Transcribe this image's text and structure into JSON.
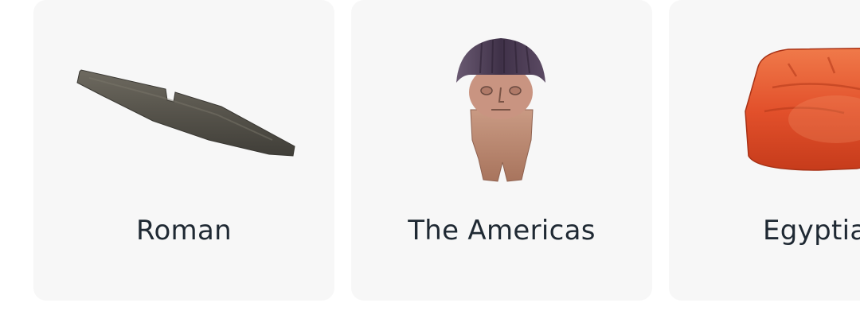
{
  "cards": [
    {
      "label": "Roman",
      "image": "stone-blade-artifact"
    },
    {
      "label": "The Americas",
      "image": "clay-figurine-artifact"
    },
    {
      "label": "Egyptian",
      "image": "carnelian-amulet-artifact"
    }
  ],
  "colors": {
    "card_background": "#f7f7f7",
    "label_text": "#1f2933",
    "blade": "#56534b",
    "figurine_head": "#4a3b55",
    "figurine_body": "#c9957a",
    "amulet": "#e2502b"
  }
}
